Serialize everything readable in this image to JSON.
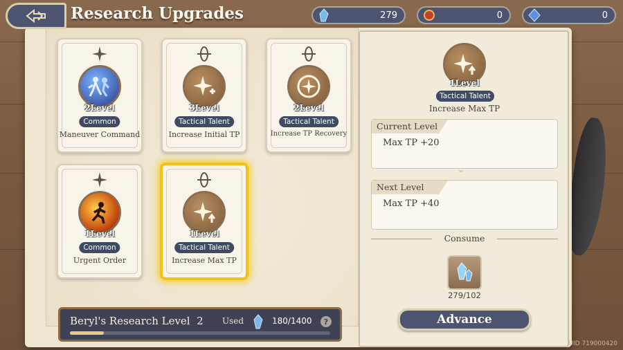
{
  "header": {
    "title": "Research Upgrades",
    "currencies": [
      {
        "icon": "blue-crystal-icon",
        "value": "279"
      },
      {
        "icon": "red-gem-icon",
        "value": "0"
      },
      {
        "icon": "diamond-crystal-icon",
        "value": "0"
      }
    ]
  },
  "cards": [
    {
      "level": "2Level",
      "tag": "Common",
      "name": "Maneuver Command",
      "icon": "maneuver-icon"
    },
    {
      "level": "3Level",
      "tag": "Tactical Talent",
      "name": "Increase Initial TP",
      "icon": "star-plus-icon"
    },
    {
      "level": "2Level",
      "tag": "Tactical Talent",
      "name": "Increase TP Recovery",
      "icon": "star-cycle-icon"
    },
    {
      "level": "1Level",
      "tag": "Common",
      "name": "Urgent Order",
      "icon": "runner-fire-icon"
    },
    {
      "level": "1Level",
      "tag": "Tactical Talent",
      "name": "Increase Max TP",
      "icon": "star-up-icon"
    }
  ],
  "research": {
    "label": "Beryl's Research Level",
    "level": "2",
    "used_label": "Used",
    "count": "180/1400",
    "help": "?",
    "progress_fraction": 0.13
  },
  "detail": {
    "level": "1Level",
    "tag": "Tactical Talent",
    "name": "Increase Max TP",
    "current_header": "Current Level",
    "current_text": "Max TP +20",
    "next_header": "Next Level",
    "next_text": "Max TP +40",
    "consume_label": "Consume",
    "cost": "279/102",
    "advance_label": "Advance"
  },
  "uid": "UID 719000420",
  "colors": {
    "accent_navy": "#4d5470",
    "selected_gold": "#f3c21a",
    "tag_bg": "#3f4a63"
  }
}
